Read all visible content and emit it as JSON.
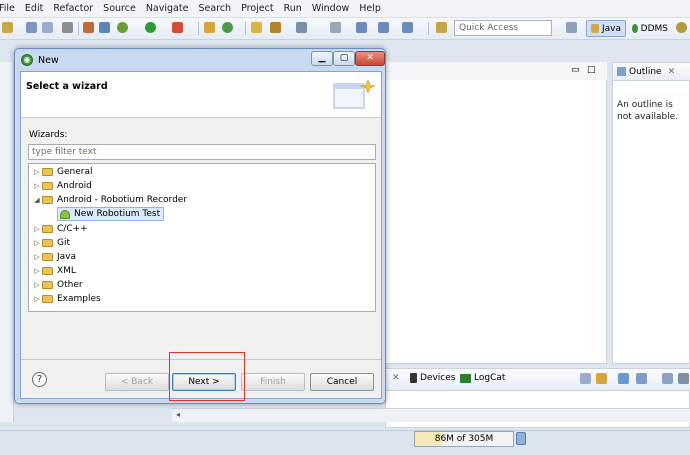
{
  "menu": [
    "File",
    "Edit",
    "Refactor",
    "Source",
    "Navigate",
    "Search",
    "Project",
    "Run",
    "Window",
    "Help"
  ],
  "toolbar": {
    "quick_access_placeholder": "Quick Access",
    "perspectives": [
      {
        "label": "Java",
        "active": true
      },
      {
        "label": "DDMS",
        "active": false
      }
    ]
  },
  "outline": {
    "tab_label": "Outline",
    "message": "An outline is not available."
  },
  "bottom_panel": {
    "tabs": [
      "Devices",
      "LogCat"
    ]
  },
  "status": {
    "heap": "86M of 305M",
    "heap_used_fraction": 0.28
  },
  "dialog": {
    "title": "New",
    "banner_title": "Select a wizard",
    "wizards_label": "Wizards:",
    "filter_placeholder": "type filter text",
    "tree": [
      {
        "label": "General",
        "expanded": false,
        "level": 0,
        "icon": "folder-icon"
      },
      {
        "label": "Android",
        "expanded": false,
        "level": 0,
        "icon": "folder-icon"
      },
      {
        "label": "Android - Robotium Recorder",
        "expanded": true,
        "level": 0,
        "icon": "folder-icon"
      },
      {
        "label": "New Robotium Test",
        "level": 1,
        "icon": "android-icon",
        "selected": true
      },
      {
        "label": "C/C++",
        "expanded": false,
        "level": 0,
        "icon": "folder-icon"
      },
      {
        "label": "Git",
        "expanded": false,
        "level": 0,
        "icon": "folder-icon"
      },
      {
        "label": "Java",
        "expanded": false,
        "level": 0,
        "icon": "folder-icon"
      },
      {
        "label": "XML",
        "expanded": false,
        "level": 0,
        "icon": "folder-icon"
      },
      {
        "label": "Other",
        "expanded": false,
        "level": 0,
        "icon": "folder-icon"
      },
      {
        "label": "Examples",
        "expanded": false,
        "level": 0,
        "icon": "folder-icon"
      }
    ],
    "buttons": {
      "help": "?",
      "back": "< Back",
      "next": "Next >",
      "finish": "Finish",
      "cancel": "Cancel"
    }
  },
  "colors": {
    "highlight": "#e0302c",
    "selection": "#dceafc",
    "title_bar": "#c8daf1"
  }
}
